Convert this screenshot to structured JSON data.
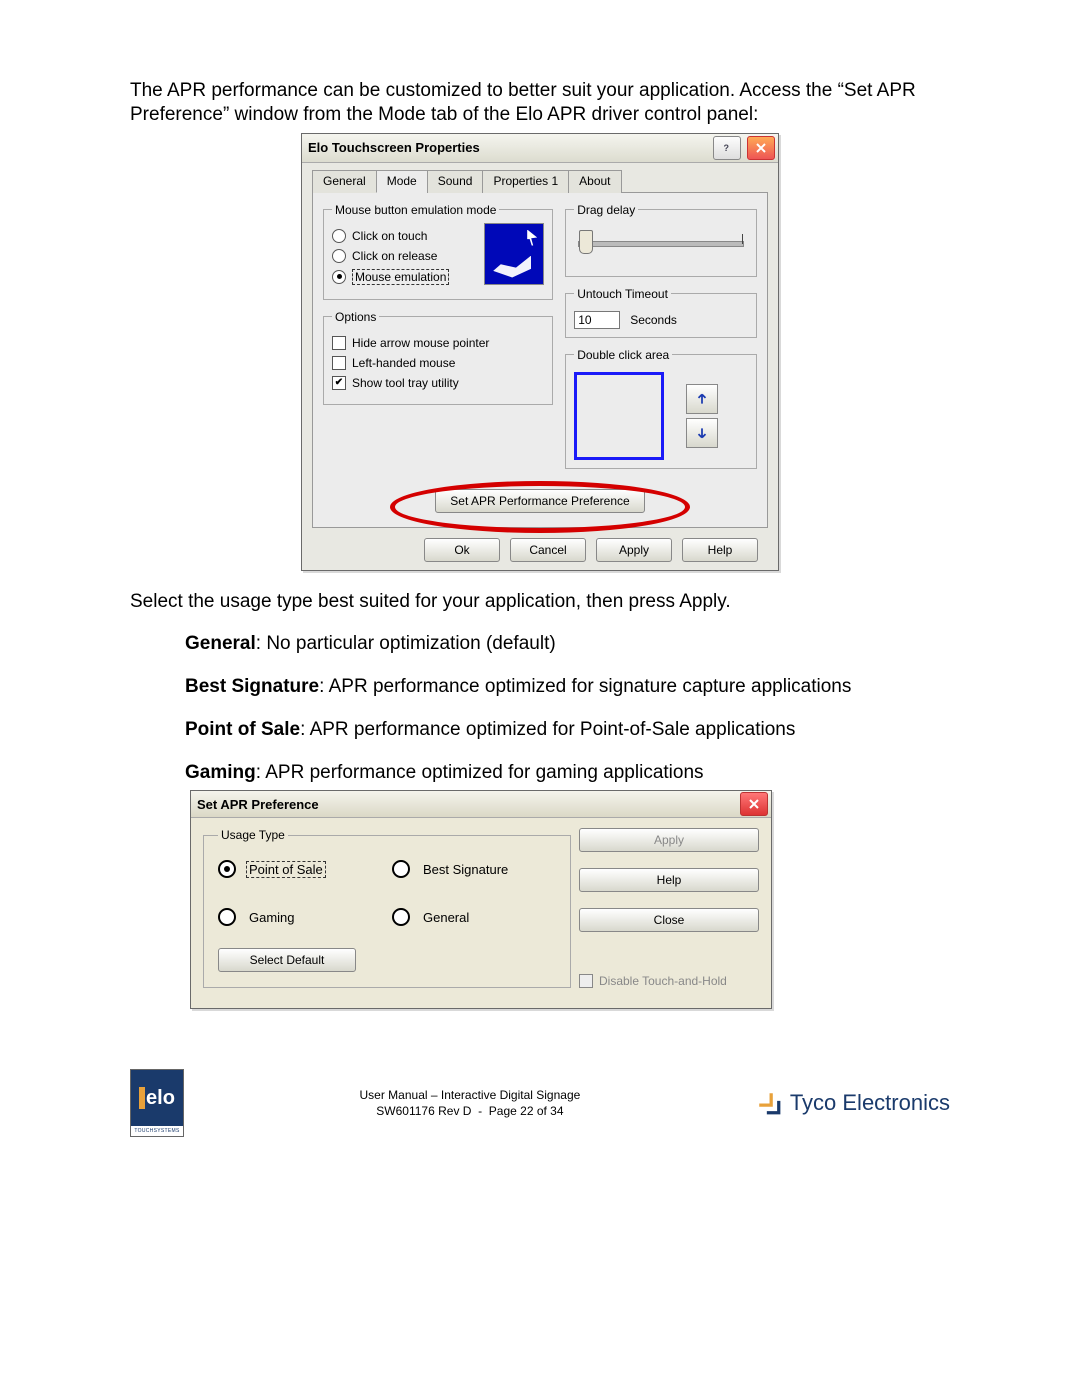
{
  "intro": "The APR performance can be customized to better suit your application.   Access the “Set APR Preference” window from the Mode tab of the Elo APR driver control panel:",
  "win1": {
    "title": "Elo Touchscreen Properties",
    "tabs": [
      "General",
      "Mode",
      "Sound",
      "Properties 1",
      "About"
    ],
    "active_tab": 1,
    "mouse_mode": {
      "legend": "Mouse button emulation mode",
      "options": [
        "Click on touch",
        "Click on release",
        "Mouse emulation"
      ],
      "selected": 2
    },
    "options": {
      "legend": "Options",
      "items": [
        {
          "label": "Hide arrow mouse pointer",
          "checked": false
        },
        {
          "label": "Left-handed mouse",
          "checked": false
        },
        {
          "label": "Show tool tray utility",
          "checked": true
        }
      ]
    },
    "drag_delay": {
      "legend": "Drag delay"
    },
    "untouch": {
      "legend": "Untouch Timeout",
      "value": "10",
      "unit": "Seconds"
    },
    "dbl_click": {
      "legend": "Double click area"
    },
    "set_apr_btn": "Set APR Performance Preference",
    "buttons": [
      "Ok",
      "Cancel",
      "Apply",
      "Help"
    ]
  },
  "mid_text": {
    "line1": "Select the usage type best suited for your application, then press Apply.",
    "general_b": "General",
    "general_t": ": No particular optimization (default)",
    "bs_b": "Best Signature",
    "bs_t": ": APR performance optimized for signature capture applications",
    "pos_b": "Point of Sale",
    "pos_t": ": APR performance optimized for Point-of-Sale applications",
    "gm_b": "Gaming",
    "gm_t": ": APR performance optimized for gaming applications"
  },
  "win2": {
    "title": "Set APR Preference",
    "legend": "Usage Type",
    "options": [
      "Point of Sale",
      "Best Signature",
      "Gaming",
      "General"
    ],
    "selected": 0,
    "select_default": "Select Default",
    "buttons": {
      "apply": "Apply",
      "help": "Help",
      "close": "Close"
    },
    "disable_th": "Disable Touch-and-Hold"
  },
  "footer": {
    "elo_sub": "TOUCHSYSTEMS",
    "line1": "User Manual – Interactive Digital Signage",
    "line2_a": "SW601176 Rev D",
    "line2_b": "Page 22 of 34",
    "tyco": "Tyco Electronics"
  }
}
